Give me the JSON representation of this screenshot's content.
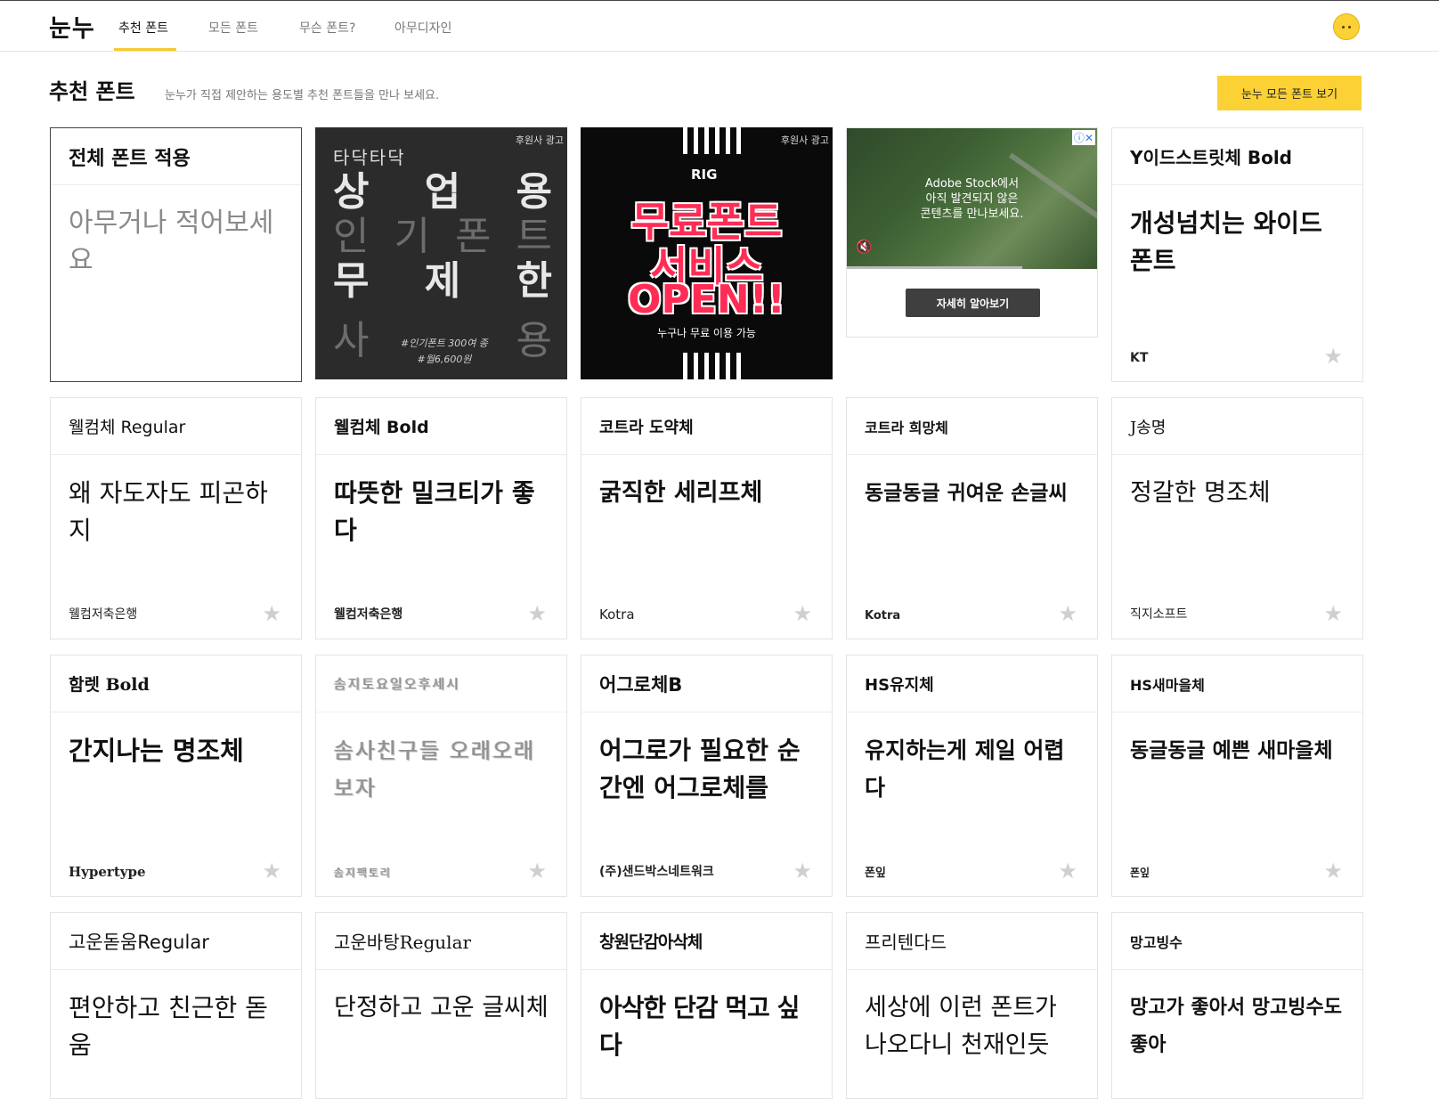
{
  "header": {
    "logo": "눈누",
    "nav": [
      "추천 폰트",
      "모든 폰트",
      "무슨 폰트?",
      "아무디자인"
    ]
  },
  "section": {
    "title": "추천 폰트",
    "subtitle": "눈누가 직접 제안하는 용도별 추천 폰트들을 만나 보세요.",
    "all_button": "눈누 모든 폰트 보기"
  },
  "apply_card": {
    "title": "전체 폰트 적용",
    "placeholder": "아무거나 적어보세요"
  },
  "ads": {
    "sponsor_label": "후원사 광고",
    "ad1": {
      "brand": "타닥타닥",
      "rows": [
        [
          "상",
          "업",
          "용"
        ],
        [
          "인",
          "기",
          "폰",
          "트"
        ],
        [
          "무",
          "제",
          "한"
        ],
        [
          "사",
          "용"
        ]
      ],
      "note_line1": "#인기폰트 300여 종",
      "note_line2": "#월6,600원"
    },
    "ad2": {
      "brand": "RIG",
      "line1": "무료폰트",
      "line2": "서비스",
      "line3": "OPEN!!",
      "sub": "누구나 무료 이용 가능"
    },
    "ad3": {
      "message_line1": "Adobe Stock에서",
      "message_line2": "아직 발견되지 않은",
      "message_line3": "콘텐츠를 만나보세요.",
      "cta": "자세히 알아보기",
      "progress": 0.7
    }
  },
  "cards": [
    {
      "title": "Y이드스트릿체 Bold",
      "preview": "개성넘치는 와이드 폰트",
      "maker": "KT"
    },
    {
      "title": "웰컴체 Regular",
      "preview": "왜 자도자도 피곤하지",
      "maker": "웰컴저축은행"
    },
    {
      "title": "웰컴체 Bold",
      "preview": "따뜻한 밀크티가 좋다",
      "maker": "웰컴저축은행"
    },
    {
      "title": "코트라 도약체",
      "preview": "굵직한 세리프체",
      "maker": "Kotra"
    },
    {
      "title": "코트라 희망체",
      "preview": "동글동글 귀여운 손글씨",
      "maker": "Kotra"
    },
    {
      "title": "J송명",
      "preview": "정갈한 명조체",
      "maker": "직지소프트"
    },
    {
      "title": "함렛 Bold",
      "preview": "간지나는 명조체",
      "maker": "Hypertype"
    },
    {
      "title": "솜지토요일오후세시",
      "preview": "솜사친구들 오래오래보자",
      "maker": "솜지팩토리"
    },
    {
      "title": "어그로체B",
      "preview": "어그로가 필요한 순간엔 어그로체를",
      "maker": "(주)샌드박스네트워크"
    },
    {
      "title": "HS유지체",
      "preview": "유지하는게 제일 어렵다",
      "maker": "폰잎"
    },
    {
      "title": "HS새마을체",
      "preview": "동글동글 예쁜 새마을체",
      "maker": "폰잎"
    },
    {
      "title": "고운돋움Regular",
      "preview": "편안하고 친근한 돋움",
      "maker": ""
    },
    {
      "title": "고운바탕Regular",
      "preview": "단정하고 고운 글씨체",
      "maker": ""
    },
    {
      "title": "창원단감아삭체",
      "preview": "아삭한 단감 먹고 싶다",
      "maker": ""
    },
    {
      "title": "프리텐다드",
      "preview": "세상에 이런 폰트가 나오다니 천재인듯",
      "maker": ""
    },
    {
      "title": "망고빙수",
      "preview": "망고가 좋아서 망고빙수도 좋아",
      "maker": ""
    }
  ],
  "colors": {
    "accent": "#fbd135",
    "star": "#cfcfcf",
    "ad_red": "#ff2d55"
  },
  "icons": {
    "star": "star-icon",
    "avatar": "avatar-face-icon",
    "mute": "speaker-mute-icon",
    "adchoices": "adchoices-icon"
  }
}
